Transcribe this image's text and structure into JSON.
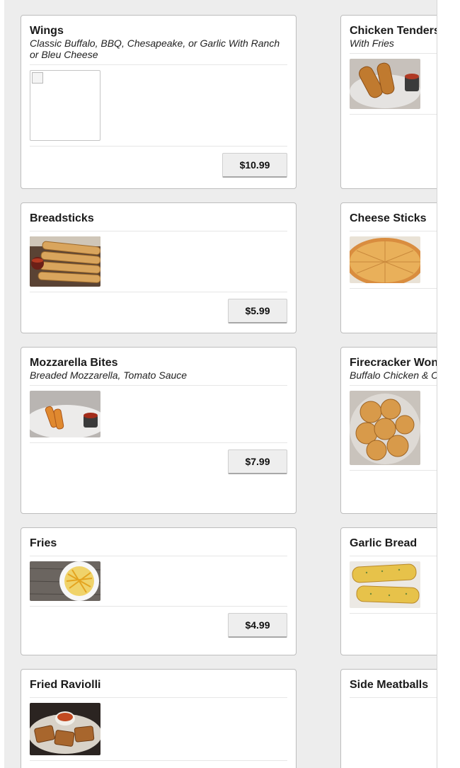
{
  "menu": {
    "left": [
      {
        "title": "Wings",
        "description": "Classic Buffalo, BBQ, Chesapeake, or Garlic With Ranch or Bleu Cheese",
        "price": "$10.99",
        "image": "broken-image-icon"
      },
      {
        "title": "Breadsticks",
        "description": "",
        "price": "$5.99",
        "image": "breadsticks-photo"
      },
      {
        "title": "Mozzarella Bites",
        "description": "Breaded Mozzarella, Tomato Sauce",
        "price": "$7.99",
        "image": "mozzarella-bites-photo"
      },
      {
        "title": "Fries",
        "description": "",
        "price": "$4.99",
        "image": "fries-photo"
      },
      {
        "title": "Fried Raviolli",
        "description": "",
        "price": "",
        "image": "fried-ravioli-photo"
      }
    ],
    "right": [
      {
        "title": "Chicken Tenders",
        "description": "With Fries",
        "image": "chicken-tenders-photo"
      },
      {
        "title": "Cheese Sticks",
        "description": "",
        "image": "cheese-sticks-photo"
      },
      {
        "title": "Firecracker Wontons",
        "description": "Buffalo Chicken & Cheese",
        "image": "wontons-photo"
      },
      {
        "title": "Garlic Bread",
        "description": "",
        "image": "garlic-bread-photo"
      },
      {
        "title": "Side Meatballs",
        "description": "",
        "image": ""
      }
    ]
  },
  "colors": {
    "page_bg": "#ededed",
    "card_bg": "#ffffff",
    "button_bg": "#eeeeee"
  }
}
